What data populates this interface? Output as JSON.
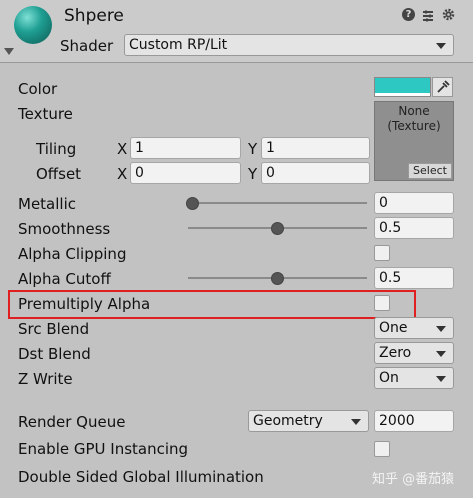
{
  "header": {
    "material_name": "Shpere",
    "shader_label": "Shader",
    "shader_value": "Custom RP/Lit"
  },
  "properties": {
    "color_label": "Color",
    "color_value": "#2ec8c2",
    "texture_label": "Texture",
    "texture_none": "None",
    "texture_type": "(Texture)",
    "texture_select": "Select",
    "tiling_label": "Tiling",
    "tiling_x_label": "X",
    "tiling_x": "1",
    "tiling_y_label": "Y",
    "tiling_y": "1",
    "offset_label": "Offset",
    "offset_x_label": "X",
    "offset_x": "0",
    "offset_y_label": "Y",
    "offset_y": "0",
    "metallic_label": "Metallic",
    "metallic_value": "0",
    "smoothness_label": "Smoothness",
    "smoothness_value": "0.5",
    "alpha_clipping_label": "Alpha Clipping",
    "alpha_cutoff_label": "Alpha Cutoff",
    "alpha_cutoff_value": "0.5",
    "premultiply_alpha_label": "Premultiply Alpha",
    "src_blend_label": "Src Blend",
    "src_blend_value": "One",
    "dst_blend_label": "Dst Blend",
    "dst_blend_value": "Zero",
    "z_write_label": "Z Write",
    "z_write_value": "On"
  },
  "advanced": {
    "render_queue_label": "Render Queue",
    "render_queue_mode": "Geometry",
    "render_queue_value": "2000",
    "gpu_instancing_label": "Enable GPU Instancing",
    "double_sided_gi_label": "Double Sided Global Illumination"
  },
  "watermark": "知乎 @番茄猿",
  "highlight_color": "#e02020"
}
